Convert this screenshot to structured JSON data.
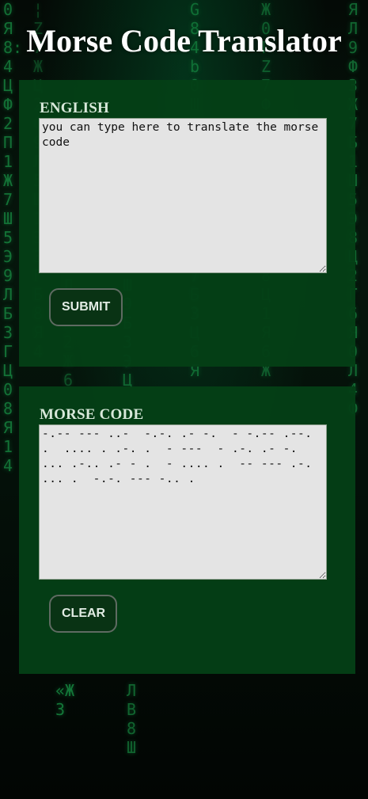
{
  "page": {
    "title": "Morse Code Translator"
  },
  "english": {
    "label": "ENGLISH",
    "text": "you can type here to translate the morse code",
    "submit_label": "SUBMIT"
  },
  "morse": {
    "label": "MORSE CODE",
    "text": "-.-- --- ..-  -.-. .- -.  - -.-- .--. .  .... . .-. .  - ---  - .-. .- -. ... .-.. .- - .  - .... .  -- --- .-. ... .  -.-. --- -.. .",
    "clear_label": "CLEAR"
  },
  "colors": {
    "panel": "#04401a",
    "background": "#040a06",
    "rain": "#1fbf5a",
    "title": "#ffffff",
    "textarea": "#e4e4e4"
  }
}
